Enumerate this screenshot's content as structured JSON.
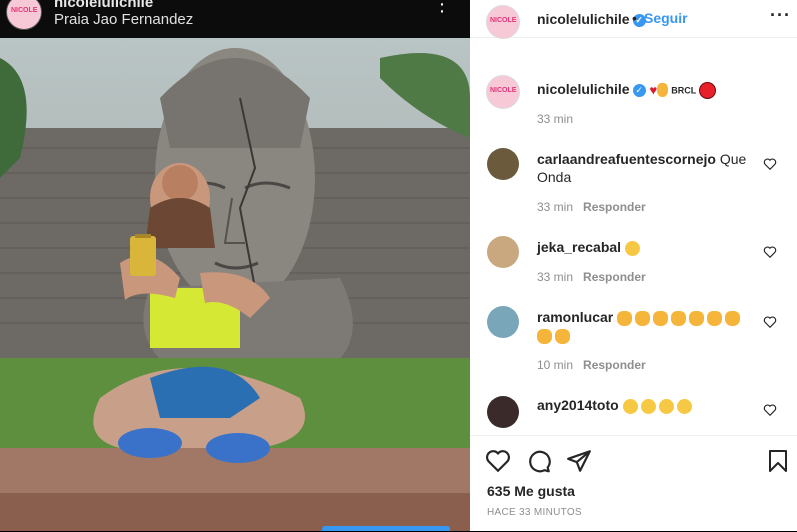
{
  "overlay": {
    "username": "nicolelulichile",
    "location": "Praia Jao Fernandez"
  },
  "header": {
    "username": "nicolelulichile",
    "separator": "•",
    "follow_label": "Seguir",
    "more": "···"
  },
  "caption": {
    "username": "nicolelulichile",
    "brcl": "BRCL",
    "time": "33 min"
  },
  "comments": [
    {
      "username": "carlaandreafuentescornejo",
      "text": "Que Onda",
      "time": "33 min",
      "reply": "Responder"
    },
    {
      "username": "jeka_recabal",
      "text": "",
      "time": "33 min",
      "reply": "Responder"
    },
    {
      "username": "ramonlucar",
      "text": "",
      "time": "10 min",
      "reply": "Responder"
    },
    {
      "username": "any2014toto",
      "text": "",
      "time": "",
      "reply": ""
    }
  ],
  "footer": {
    "likes": "635 Me gusta",
    "ago": "HACE 33 MINUTOS"
  },
  "colors": {
    "accent": "#3897f0",
    "text": "#262626",
    "muted": "#8e8e8e"
  }
}
